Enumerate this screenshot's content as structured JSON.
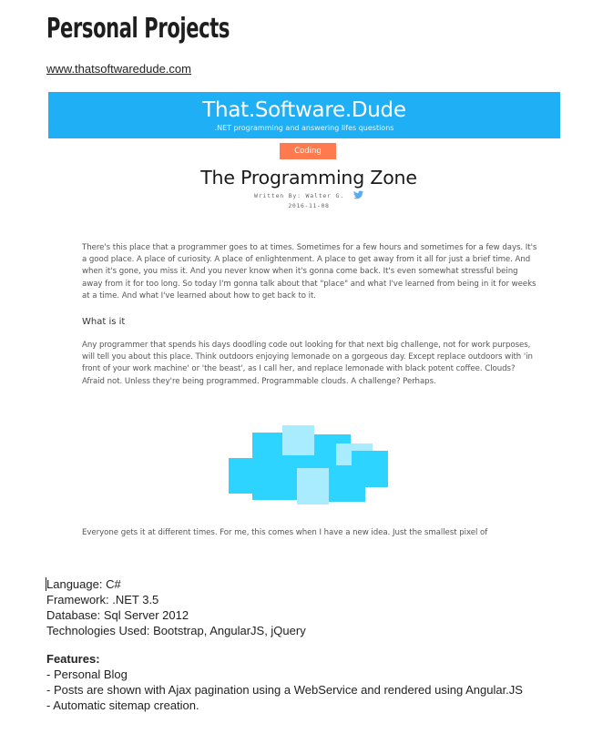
{
  "page": {
    "title": "Personal Projects",
    "link_text": "www.thatsoftwaredude.com"
  },
  "screenshot": {
    "site_title": "That.Software.Dude",
    "site_tagline": ".NET programming and answering lifes questions",
    "category_badge": "Coding",
    "post_title": "The Programming Zone",
    "byline": "Written By: Walter G.",
    "date": "2016-11-08",
    "twitter_icon": "twitter-bird-icon",
    "paragraph_1": "There's this place that a programmer goes to at times. Sometimes for a few hours and sometimes for a few days. It's a good place. A place of curiosity. A place of enlightenment. A place to get away from it all for just a brief time. And when it's gone, you miss it. And you never know when it's gonna come back. It's even somewhat stressful being away from it for too long. So today I'm gonna talk about that \"place\" and what I've learned from being in it for weeks at a time. And what I've learned about how to get back to it.",
    "heading_1": "What is it",
    "paragraph_2": "Any programmer that spends his days doodling code out looking for that next big challenge, not for work purposes, will tell you about this place. Think outdoors enjoying lemonade on a gorgeous day. Except replace outdoors with 'in front of your work machine' or 'the beast', as I call her, and replace lemonade with black potent coffee. Clouds? Afraid not. Unless they're being programmed. Programmable clouds. A challenge? Perhaps.",
    "paragraph_3": "Everyone gets it at different times. For me, this comes when I have a new idea. Just the smallest pixel of",
    "colors": {
      "header_blue": "#1eaff5",
      "badge_coral": "#ff7b4f",
      "cloud_dark": "#2dd4ff",
      "cloud_light": "#a9ecff",
      "twitter_blue": "#55acee"
    }
  },
  "specs": {
    "language": "Language: C#",
    "framework": "Framework: .NET 3.5",
    "database": "Database: Sql Server 2012",
    "technologies": "Technologies Used: Bootstrap, AngularJS, jQuery"
  },
  "features": {
    "heading": "Features:",
    "items": [
      "- Personal Blog",
      "- Posts are shown with Ajax pagination using a WebService and rendered using Angular.JS",
      "- Automatic sitemap creation."
    ]
  }
}
